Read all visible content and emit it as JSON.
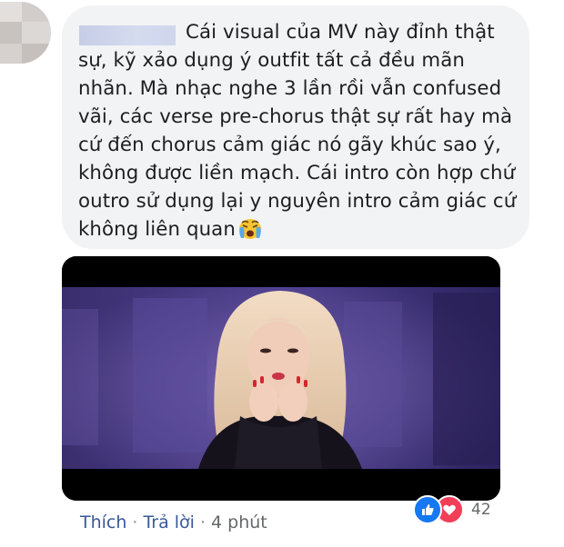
{
  "comment": {
    "text": "Cái visual của MV này đỉnh thật sự, kỹ xảo dụng ý outfit tất cả đều mãn nhãn. Mà nhạc nghe 3 lần rồi vẫn confused vãi, các verse pre-chorus thật sự rất hay mà cứ đến chorus cảm giác nó gãy khúc sao ý, không được liền mạch. Cái intro còn hợp chứ outro sử dụng lại y nguyên intro cảm giác cứ không liên quan",
    "emoji": "crying-face"
  },
  "reactions": {
    "count": "42",
    "types": [
      "like",
      "love"
    ]
  },
  "actions": {
    "like_label": "Thích",
    "separator": "·",
    "reply_label": "Trả lời",
    "time": "4 phút"
  },
  "colors": {
    "bubble": "#f2f3f5",
    "link": "#385898",
    "like": "#1877f2",
    "love": "#f33e58"
  }
}
